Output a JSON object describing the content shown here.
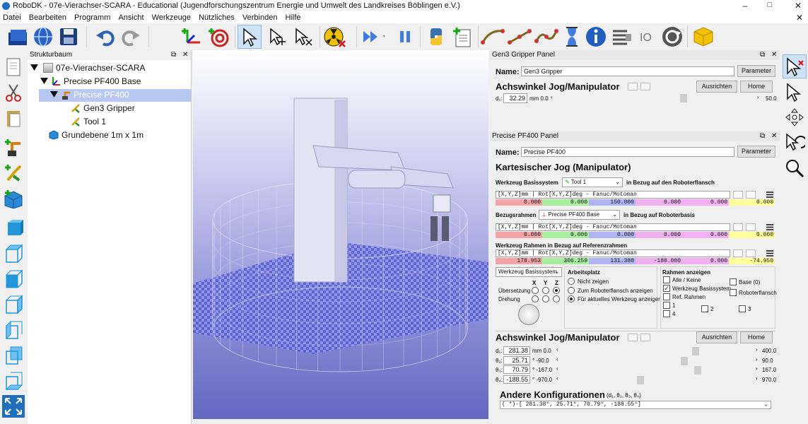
{
  "window": {
    "title": "RoboDK - 07e-Vierachser-SCARA - Educational (Jugendforschungszentrum Energie und Umwelt des Landkreises Böblingen e.V.)",
    "minimize": "–",
    "maximize": "□",
    "close": "✕"
  },
  "menu": [
    "Datei",
    "Bearbeiten",
    "Programm",
    "Ansicht",
    "Werkzeuge",
    "Nützliches",
    "Verbinden",
    "Hilfe"
  ],
  "tree": {
    "panel_title": "Strukturbaum",
    "root": "07e-Vierachser-SCARA",
    "base": "Precise PF400 Base",
    "robot": "Precise PF400",
    "gripper": "Gen3 Gripper",
    "tool": "Tool 1",
    "ground": "Grundebene 1m x 1m"
  },
  "gripper_panel": {
    "title": "Gen3 Gripper Panel",
    "name_label": "Name:",
    "name_value": "Gen3 Gripper",
    "param_button": "Parameter",
    "jog_title": "Achswinkel Jog/Manipulator",
    "align_button": "Ausrichten",
    "home_button": "Home",
    "joint_label": "d₁:",
    "joint_value": "32.29",
    "joint_min": "mm 0.0",
    "joint_max": "50.0",
    "joint_fraction": 0.646
  },
  "robot_panel": {
    "title": "Precise PF400 Panel",
    "name_label": "Name:",
    "name_value": "Precise PF400",
    "param_button": "Parameter",
    "cart_title": "Kartesischer Jog (Manipulator)",
    "tool_base_label": "Werkzeug Basissystem",
    "tool_select": "Tool 1",
    "tool_ref_text": "in Bezug auf den Roboterflansch",
    "format_string": "[X,Y,Z]mm | Rot[X,Y,Z]deg - Fanuc/Motoman",
    "tool_values": [
      "0.000",
      "0.000",
      "150.000",
      "0.000",
      "0.000",
      "0.000"
    ],
    "ref_frame_label": "Bezugsrahmen",
    "ref_select": "Precise PF400 Base",
    "ref_text": "in Bezug auf Roboterbasis",
    "ref_values": [
      "0.000",
      "0.000",
      "0.000",
      "0.000",
      "0.000",
      "0.000"
    ],
    "tool_in_ref_title": "Werkzeug Rahmen in Bezug auf Referenzrahmen",
    "tool_in_ref_values": [
      "178.953",
      "306.259",
      "131.380",
      "-180.000",
      "0.000",
      "-74.950"
    ],
    "jog_mode_select": "Werkzeug Basissystem",
    "axes": [
      "X",
      "Y",
      "Z"
    ],
    "translation_label": "Übersetzung",
    "rotation_label": "Drehung",
    "workspace_title": "Arbeitsplatz",
    "workspace_options": [
      "Nicht zeigen",
      "Zum Roboterflansch anzeigen",
      "Für aktuelles Werkzeug anzeigen"
    ],
    "frames_title": "Rahmen anzeigen",
    "frames_options": [
      "Alle / Keine",
      "Werkzeug Basissystem",
      "Ref. Rahmen",
      "1",
      "4",
      "2",
      "3",
      "Base (0)",
      "Roboterflansch"
    ],
    "joint_jog_title": "Achswinkel Jog/Manipulator",
    "align_button": "Ausrichten",
    "home_button": "Home",
    "joints": [
      {
        "label": "d₁:",
        "value": "281.38",
        "min": "mm 0.0",
        "max": "400.0",
        "fraction": 0.703
      },
      {
        "label": "θ₂:",
        "value": "25.71",
        "min": "° -90.0",
        "max": "90.0",
        "fraction": 0.643
      },
      {
        "label": "θ₃:",
        "value": "70.79",
        "min": "° -167.0",
        "max": "167.0",
        "fraction": 0.712
      },
      {
        "label": "θ₄:",
        "value": "-188.55",
        "min": "° -970.0",
        "max": "970.0",
        "fraction": 0.403
      }
    ],
    "other_configs_title": "Andere Konfigurationen",
    "other_configs_sub": "(d₁, θ₂, θ₃, θ₄)",
    "config_value": "( *)-[ 281.38°,   25.71°,   70.79°, -188.55°]"
  },
  "colors": {
    "x": "#f4a3a8",
    "y": "#a8f0a0",
    "z": "#b0b4f5",
    "rx": "#f0b0f0",
    "ry": "#f4b0f4",
    "rz": "#ffff99",
    "selection": "#b8c8f0"
  }
}
